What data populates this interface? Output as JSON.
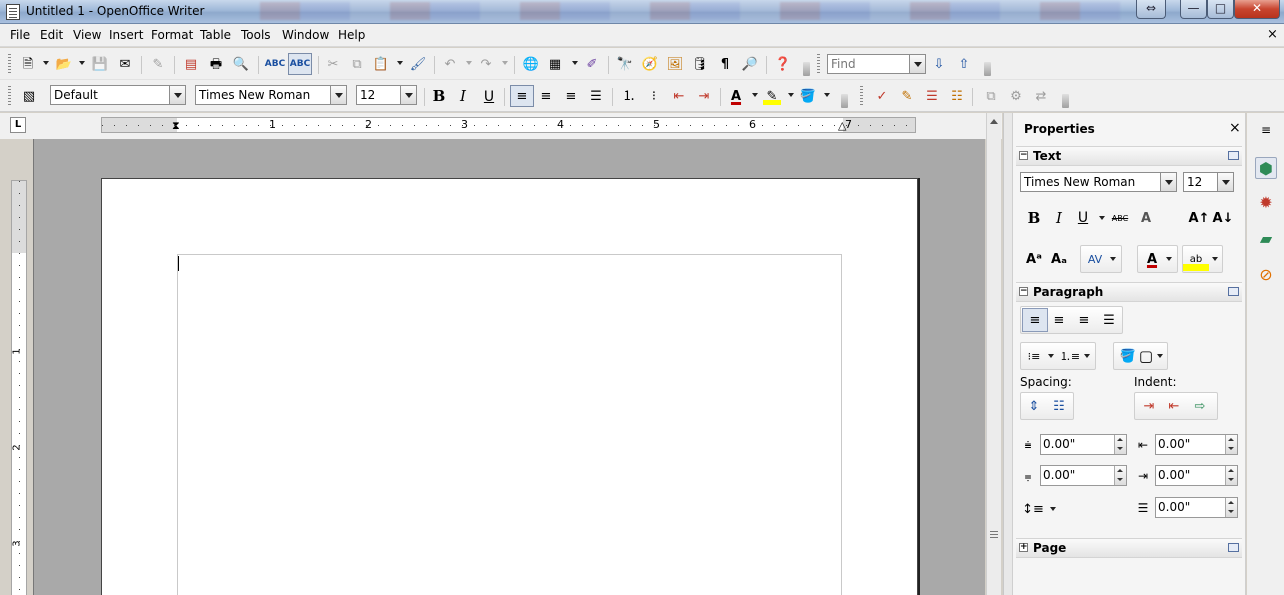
{
  "window": {
    "title": "Untitled 1 - OpenOffice Writer",
    "buttons": {
      "restore_down": "⇔",
      "minimize": "—",
      "maximize": "□",
      "close": "✕"
    }
  },
  "menubar": {
    "items": [
      "File",
      "Edit",
      "View",
      "Insert",
      "Format",
      "Table",
      "Tools",
      "Window",
      "Help"
    ],
    "close_glyph": "×"
  },
  "standard_toolbar": {
    "find_placeholder": "Find"
  },
  "formatting_toolbar": {
    "paragraph_style": "Default",
    "font_name": "Times New Roman",
    "font_size": "12",
    "bold": "B",
    "italic": "I",
    "underline": "U"
  },
  "ruler": {
    "tab_stop_glyph": "L",
    "h_numbers": [
      "1",
      "2",
      "3",
      "4",
      "5",
      "6",
      "7"
    ],
    "v_numbers": [
      "1",
      "2",
      "3"
    ]
  },
  "sidebar": {
    "title": "Properties",
    "close_glyph": "×",
    "text_panel": {
      "title": "Text",
      "font_name": "Times New Roman",
      "font_size": "12",
      "bold": "B",
      "italic": "I",
      "underline": "U",
      "strike": "ABC"
    },
    "paragraph_panel": {
      "title": "Paragraph",
      "spacing_label": "Spacing:",
      "indent_label": "Indent:",
      "above_spacing": "0.00\"",
      "below_spacing": "0.00\"",
      "before_indent": "0.00\"",
      "after_indent": "0.00\"",
      "first_line_indent": "0.00\""
    },
    "page_panel": {
      "title": "Page"
    }
  },
  "colors": {
    "chrome": "#f0f0f0",
    "document_bg": "#a9a9a9",
    "font_color_red": "#c00000",
    "highlight_yellow": "#ffff00"
  }
}
